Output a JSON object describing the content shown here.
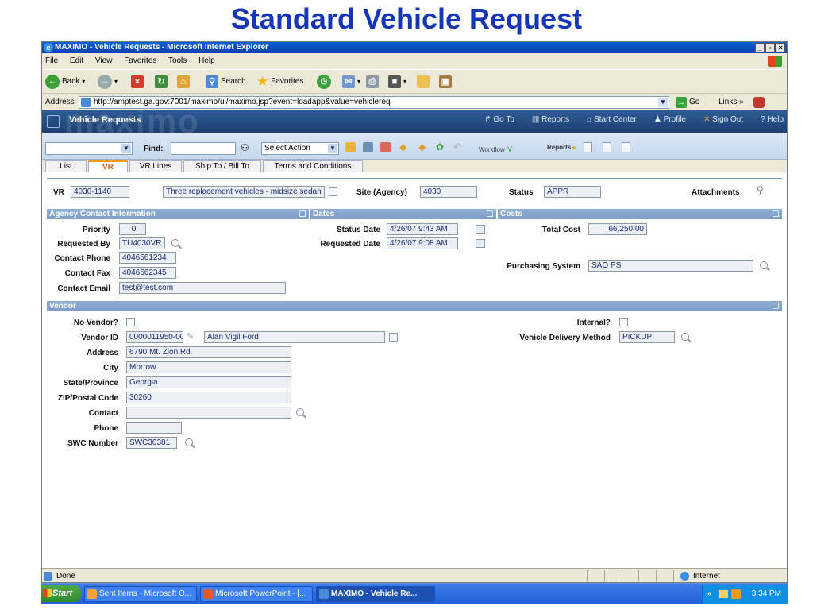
{
  "slide_title": "Standard Vehicle Request",
  "window": {
    "title": "MAXIMO - Vehicle Requests - Microsoft Internet Explorer",
    "menu": [
      "File",
      "Edit",
      "View",
      "Favorites",
      "Tools",
      "Help"
    ],
    "toolbar": {
      "back": "Back",
      "search": "Search",
      "favorites": "Favorites"
    },
    "address_label": "Address",
    "address_url": "http://amptest.ga.gov:7001/maximo/ui/maximo.jsp?event=loadapp&value=vehiclereq",
    "go": "Go",
    "links": "Links"
  },
  "maximo_header": {
    "logo": "maximo",
    "app_title": "Vehicle Requests",
    "links": [
      "Go To",
      "Reports",
      "Start Center",
      "Profile",
      "Sign Out",
      "? Help"
    ]
  },
  "actionbar": {
    "find_label": "Find:",
    "select_action": "Select Action",
    "workflow": "Workflow",
    "reports": "Reports"
  },
  "tabs": [
    "List",
    "VR",
    "VR Lines",
    "Ship To / Bill To",
    "Terms and Conditions"
  ],
  "header_fields": {
    "vr_label": "VR",
    "vr_value": "4030-1140",
    "description": "Three replacement vehicles - midsize sedan",
    "site_label": "Site (Agency)",
    "site_value": "4030",
    "status_label": "Status",
    "status_value": "APPR",
    "attachments_label": "Attachments"
  },
  "sections": {
    "agency_contact": "Agency Contact Information",
    "dates": "Dates",
    "costs": "Costs",
    "vendor": "Vendor"
  },
  "agency": {
    "priority_label": "Priority",
    "priority": "0",
    "requested_by_label": "Requested By",
    "requested_by": "TU4030VR",
    "phone_label": "Contact Phone",
    "phone": "4046561234",
    "fax_label": "Contact Fax",
    "fax": "4046562345",
    "email_label": "Contact Email",
    "email": "test@test.com"
  },
  "dates": {
    "status_date_label": "Status Date",
    "status_date": "4/26/07 9:43 AM",
    "requested_date_label": "Requested Date",
    "requested_date": "4/26/07 9:08 AM"
  },
  "costs": {
    "total_cost_label": "Total Cost",
    "total_cost": "66,250.00",
    "purchasing_label": "Purchasing System",
    "purchasing": "SAO PS"
  },
  "vendor": {
    "no_vendor_label": "No Vendor?",
    "vendor_id_label": "Vendor ID",
    "vendor_id": "0000011950-00",
    "vendor_name": "Alan Vigil Ford",
    "address_label": "Address",
    "address": "6790 Mt. Zion Rd.",
    "city_label": "City",
    "city": "Morrow",
    "state_label": "State/Province",
    "state": "Georgia",
    "zip_label": "ZIP/Postal Code",
    "zip": "30260",
    "contact_label": "Contact",
    "contact": "",
    "phone_label": "Phone",
    "phone": "",
    "swc_label": "SWC Number",
    "swc": "SWC30381",
    "internal_label": "Internal?",
    "delivery_label": "Vehicle Delivery Method",
    "delivery": "PICKUP"
  },
  "statusbar": {
    "left": "Done",
    "zone": "Internet"
  },
  "taskbar": {
    "start": "Start",
    "tasks": [
      "Sent Items - Microsoft O...",
      "Microsoft PowerPoint - [...",
      "MAXIMO - Vehicle Re..."
    ],
    "time": "3:34 PM"
  }
}
